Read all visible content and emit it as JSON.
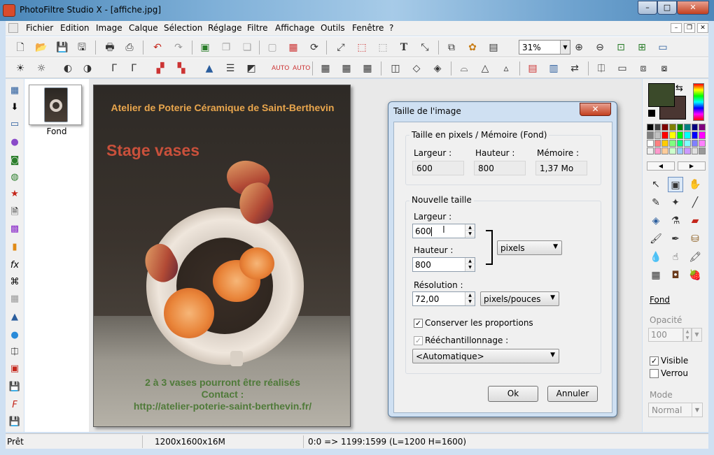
{
  "window": {
    "title": "PhotoFiltre Studio X - [affiche.jpg]",
    "controls": {
      "minimize": "–",
      "maximize": "□",
      "close": "✕"
    }
  },
  "menu": [
    "Fichier",
    "Edition",
    "Image",
    "Calque",
    "Sélection",
    "Réglage",
    "Filtre",
    "Affichage",
    "Outils",
    "Fenêtre",
    "?"
  ],
  "toolbar": {
    "zoom": "31%"
  },
  "thumbnail": {
    "label": "Fond"
  },
  "canvas_text": {
    "line1": "Atelier de Poterie Céramique de Saint-Berthevin",
    "title": "Stage vases",
    "footer1": "2 à 3 vases pourront être réalisés",
    "footer2": "Contact :",
    "footer3": "http://atelier-poterie-saint-berthevin.fr/"
  },
  "dialog": {
    "title": "Taille de l'image",
    "close": "✕",
    "current_group": "Taille en pixels / Mémoire (Fond)",
    "current": {
      "width_label": "Largeur :",
      "width": "600",
      "height_label": "Hauteur :",
      "height": "800",
      "memory_label": "Mémoire :",
      "memory": "1,37 Mo"
    },
    "new_group": "Nouvelle taille",
    "new": {
      "width_label": "Largeur :",
      "width": "600",
      "height_label": "Hauteur :",
      "height": "800",
      "unit": "pixels",
      "resolution_label": "Résolution :",
      "resolution": "72,00",
      "resolution_unit": "pixels/pouces",
      "keep_proportions": "Conserver les proportions",
      "keep_proportions_checked": true,
      "resample": "Rééchantillonnage :",
      "resample_checked": true,
      "resample_method": "<Automatique>"
    },
    "ok": "Ok",
    "cancel": "Annuler"
  },
  "right_panel": {
    "layer_name": "Fond",
    "opacity_label": "Opacité",
    "opacity": "100",
    "visible": "Visible",
    "visible_checked": true,
    "lock": "Verrou",
    "lock_checked": false,
    "mode_label": "Mode",
    "mode": "Normal",
    "foreground_color": "#3b4a2a",
    "background_color": "#4a3632",
    "palette": [
      "#000000",
      "#404040",
      "#800000",
      "#808000",
      "#008000",
      "#008080",
      "#000080",
      "#800080",
      "#808080",
      "#c0c0c0",
      "#ff0000",
      "#ffff00",
      "#00ff00",
      "#00ffff",
      "#0000ff",
      "#ff00ff",
      "#ffffff",
      "#ff8080",
      "#ffcc00",
      "#80ff80",
      "#00ff80",
      "#80ffff",
      "#8080ff",
      "#ff80ff",
      "#f0f0f0",
      "#ff99cc",
      "#ffcc99",
      "#ccffcc",
      "#99ccff",
      "#cc99ff",
      "#e0e0e0",
      "#999999"
    ]
  },
  "status": {
    "state": "Prêt",
    "size": "1200x1600x16M",
    "coords": "0:0 => 1199:1599 (L=1200  H=1600)"
  }
}
